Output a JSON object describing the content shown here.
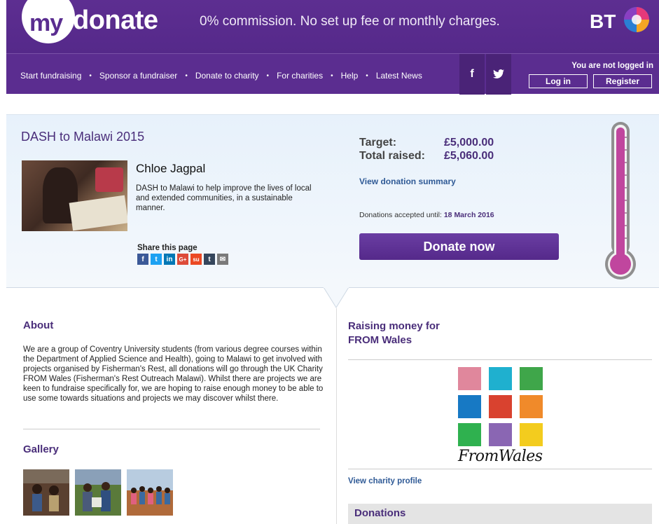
{
  "header": {
    "logo_my": "my",
    "logo_donate": "donate",
    "tagline": "0% commission. No set up fee or monthly charges.",
    "partner": "BT"
  },
  "nav": {
    "items": [
      "Start fundraising",
      "Sponsor a fundraiser",
      "Donate to charity",
      "For charities",
      "Help",
      "Latest News"
    ],
    "separator": "•",
    "facebook": "f",
    "twitter": "🐦",
    "login_status": "You are not logged in",
    "login": "Log in",
    "register": "Register"
  },
  "campaign": {
    "title": "DASH to Malawi 2015",
    "fundraiser_name": "Chloe Jagpal",
    "description": "DASH to Malawi to help improve the lives of local and extended communities, in a sustainable manner.",
    "share_label": "Share this page",
    "share_icons": [
      "f",
      "t",
      "in",
      "G+",
      "su",
      "t",
      "✉"
    ],
    "target_label": "Target:",
    "target_value": "£5,000.00",
    "raised_label": "Total raised:",
    "raised_value": "£5,060.00",
    "summary_link": "View donation summary",
    "until_label": "Donations accepted until:",
    "until_value": "18 March 2016",
    "donate_button": "Donate now",
    "progress_fraction": 1.0
  },
  "about": {
    "heading": "About",
    "text": "We are a group of Coventry University students (from various degree courses within the Department of Applied Science and Health), going to Malawi to get involved with projects organised by Fisherman's Rest, all donations will go through the UK Charity FROM Wales (Fisherman's Rest Outreach Malawi). Whilst there are projects we are keen to fundraise specifically for, we are hoping to raise enough money to be able to use some towards situations and projects we may discover whilst there."
  },
  "gallery": {
    "heading": "Gallery"
  },
  "charity": {
    "heading_line1": "Raising money for",
    "heading_line2": "FROM Wales",
    "wordmark": "FromWales",
    "profile_link": "View charity profile",
    "tile_colors": [
      "#e0879c",
      "#1fb0cf",
      "#3fa64a",
      "#1779c4",
      "#d9422f",
      "#f08a2a",
      "#2fb14f",
      "#8a66b3",
      "#f3cc1e"
    ]
  },
  "donations": {
    "heading": "Donations"
  }
}
